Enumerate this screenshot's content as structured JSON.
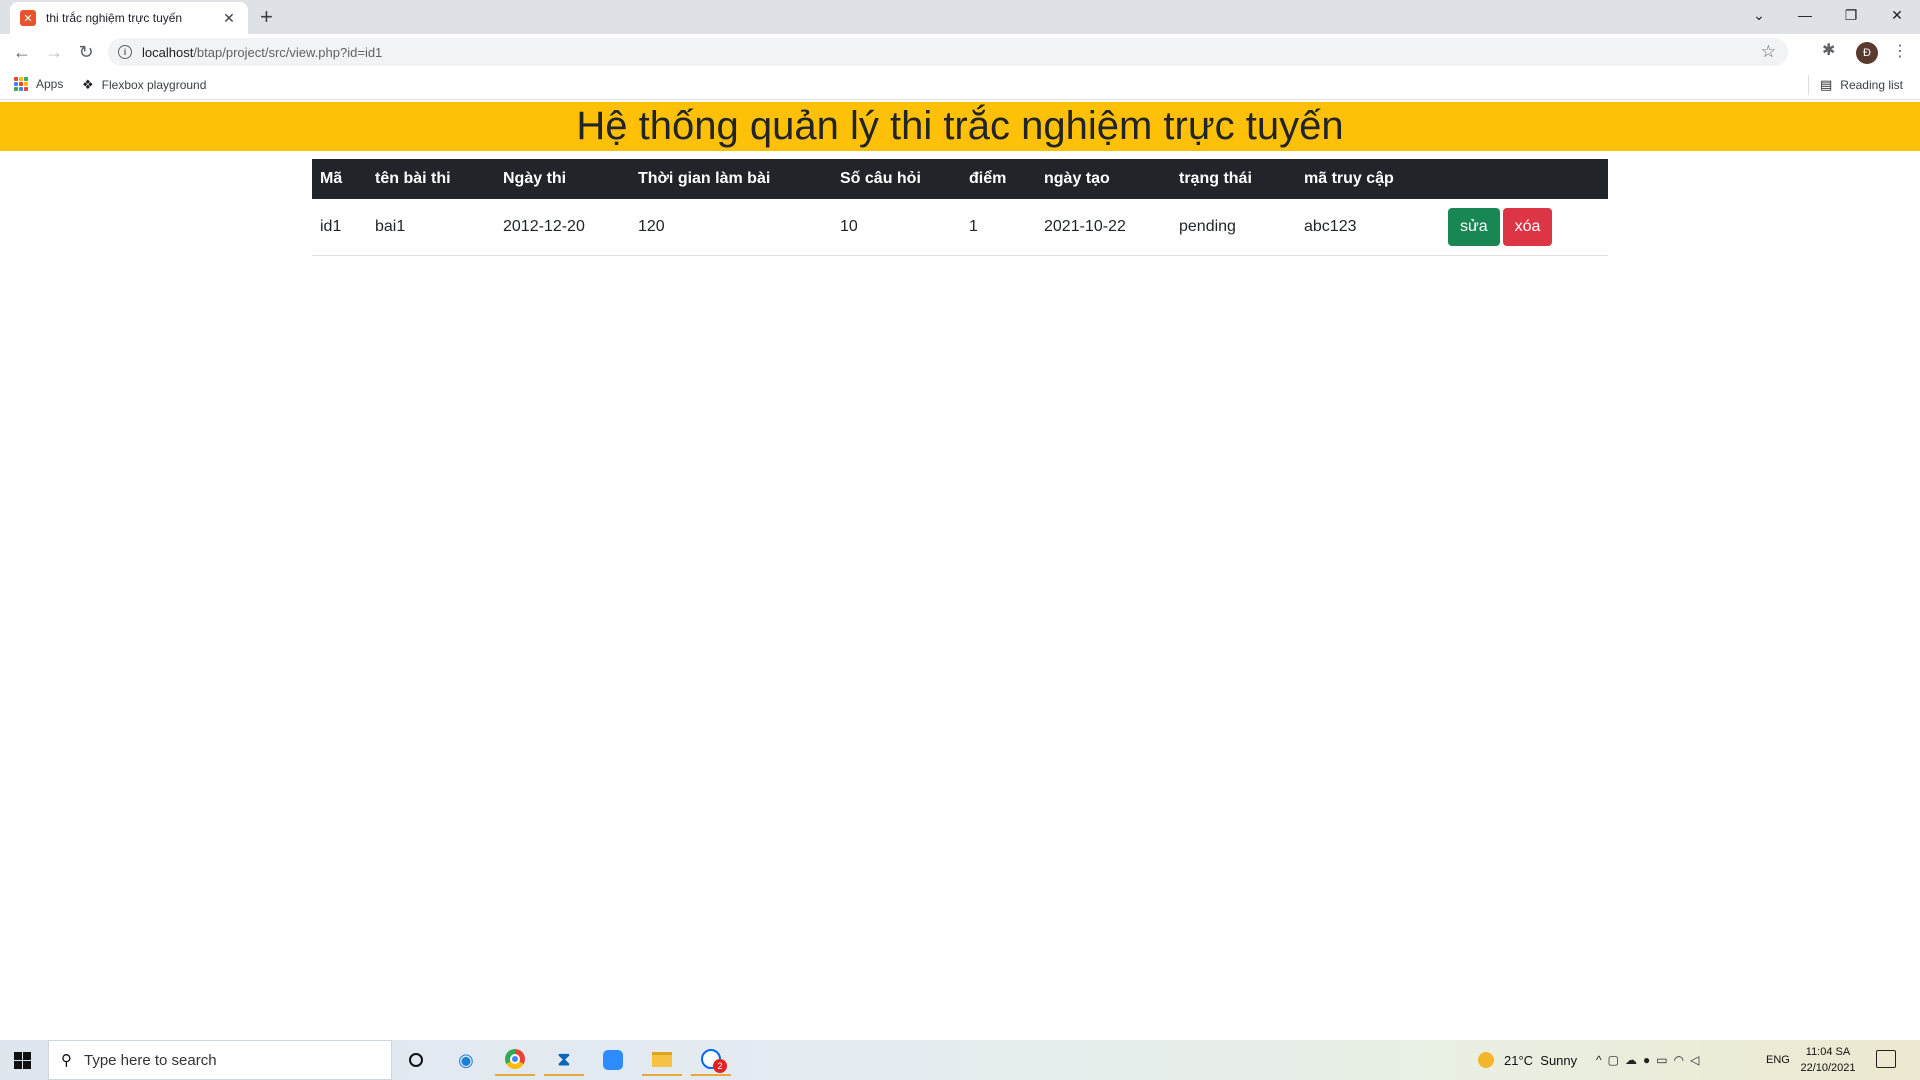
{
  "browser": {
    "tab_title": "thi trắc nghiệm trực tuyến",
    "tab_close": "✕",
    "new_tab": "+",
    "url_host": "localhost",
    "url_path": "/btap/project/src/view.php?id=id1",
    "profile_initial": "Đ",
    "bookmarks": {
      "apps": "Apps",
      "flexbox": "Flexbox playground",
      "reading_list": "Reading list"
    }
  },
  "page": {
    "title": "Hệ thống quản lý thi trắc nghiệm trực tuyến",
    "header_color": "#ffc107",
    "table": {
      "columns": [
        "Mã",
        "tên bài thi",
        "Ngày thi",
        "Thời gian làm bài",
        "Số câu hỏi",
        "điểm",
        "ngày tạo",
        "trạng thái",
        "mã truy cập",
        ""
      ],
      "rows": [
        {
          "ma": "id1",
          "ten_bai_thi": "bai1",
          "ngay_thi": "2012-12-20",
          "thoi_gian": "120",
          "so_cau_hoi": "10",
          "diem": "1",
          "ngay_tao": "2021-10-22",
          "trang_thai": "pending",
          "ma_truy_cap": "abc123",
          "edit_label": "sửa",
          "delete_label": "xóa"
        }
      ]
    }
  },
  "taskbar": {
    "search_placeholder": "Type here to search",
    "weather": "21°C  Sunny",
    "language": "ENG",
    "time": "11:04 SA",
    "date": "22/10/2021",
    "zalo_badge": "2"
  }
}
